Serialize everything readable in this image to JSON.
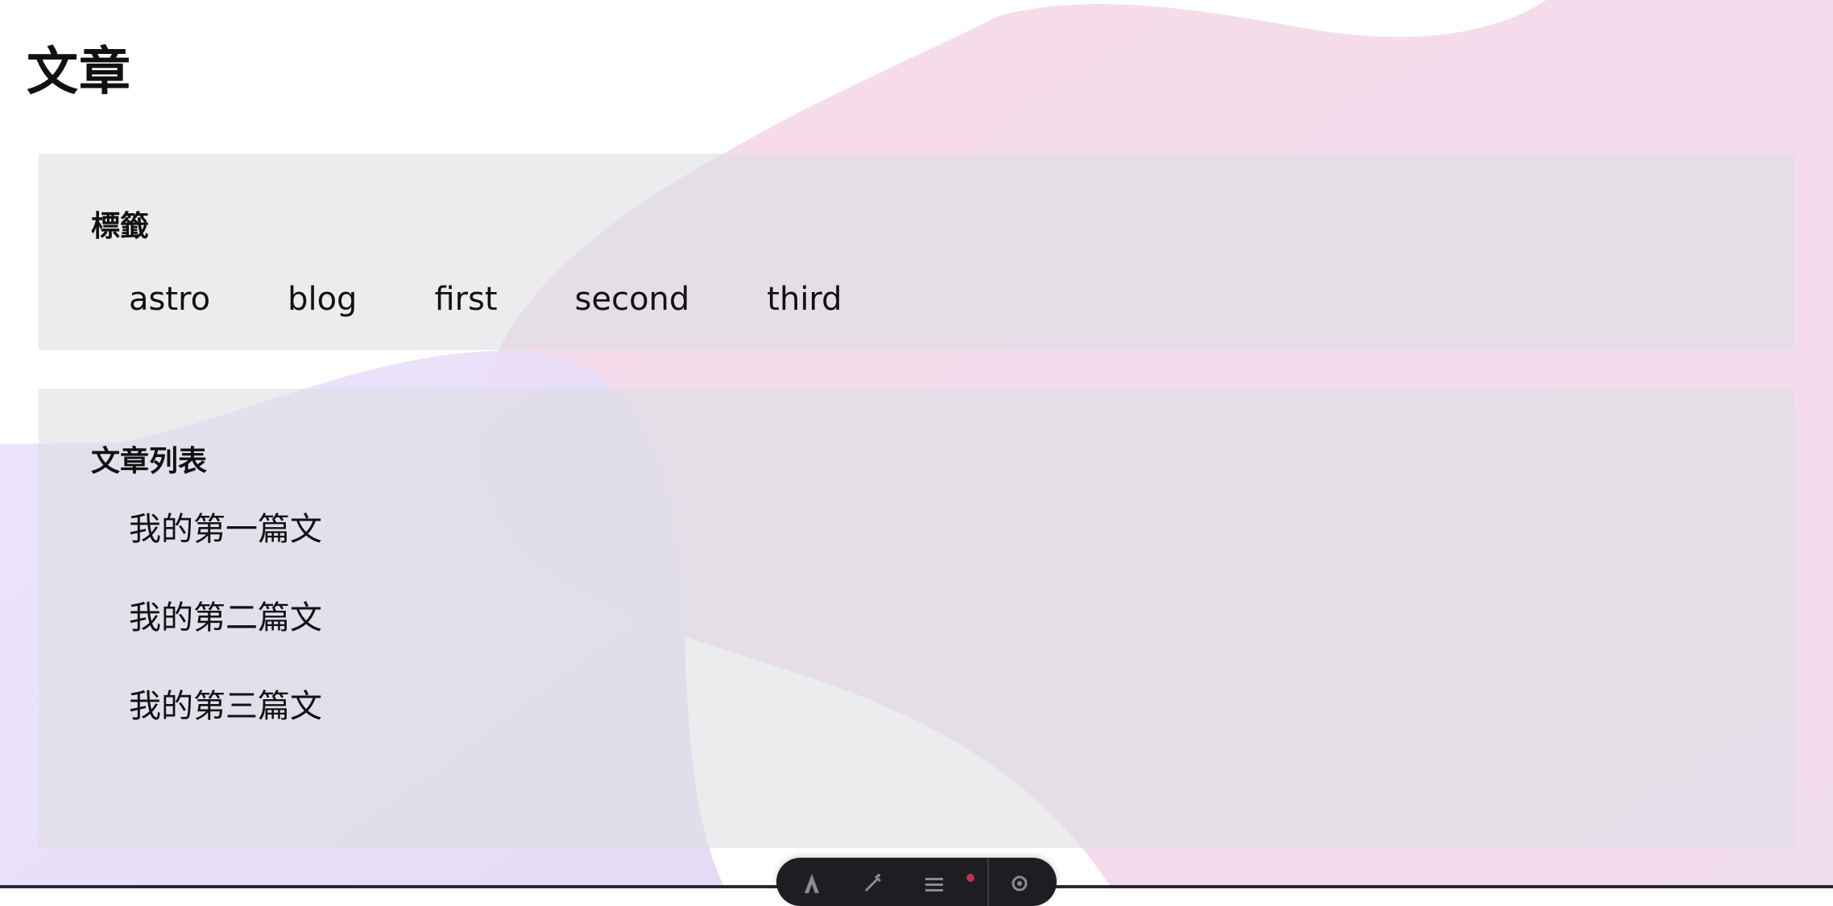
{
  "page": {
    "title": "文章"
  },
  "tags_section": {
    "heading": "標籤",
    "tags": [
      "astro",
      "blog",
      "first",
      "second",
      "third"
    ]
  },
  "posts_section": {
    "heading": "文章列表",
    "posts": [
      "我的第一篇文",
      "我的第二篇文",
      "我的第三篇文"
    ]
  },
  "toolbar": {
    "icons": [
      "astro-logo-icon",
      "inspect-icon",
      "menu-icon",
      "settings-icon"
    ]
  },
  "colors": {
    "panel_bg": "#e1e4e5",
    "blob_pink": "#f3d6e6",
    "blob_lavender": "#e5dcf7",
    "toolbar_bg": "#1d1d22",
    "notification_dot": "#c0304a"
  }
}
